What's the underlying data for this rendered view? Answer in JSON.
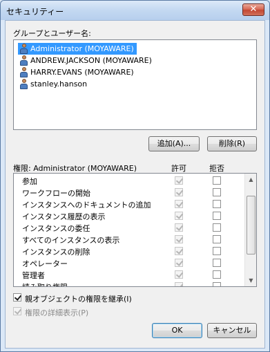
{
  "window": {
    "title": "セキュリティー",
    "close_symbol": "✕"
  },
  "users_label": "グループとユーザー名:",
  "users": [
    {
      "name": "Administrator (MOYAWARE)",
      "selected": true
    },
    {
      "name": "ANDREW.JACKSON (MOYAWARE)",
      "selected": false
    },
    {
      "name": "HARRY.EVANS (MOYAWARE)",
      "selected": false
    },
    {
      "name": "stanley.hanson",
      "selected": false
    }
  ],
  "buttons": {
    "add": "追加(A)...",
    "remove": "削除(R)",
    "ok": "OK",
    "cancel": "キャンセル"
  },
  "permissions_header": {
    "title": "権限: Administrator (MOYAWARE)",
    "allow": "許可",
    "deny": "拒否"
  },
  "permissions": [
    {
      "name": "参加",
      "allow": true,
      "deny": false
    },
    {
      "name": "ワークフローの開始",
      "allow": true,
      "deny": false
    },
    {
      "name": "インスタンスへのドキュメントの追加",
      "allow": true,
      "deny": false
    },
    {
      "name": "インスタンス履歴の表示",
      "allow": true,
      "deny": false
    },
    {
      "name": "インスタンスの委任",
      "allow": true,
      "deny": false
    },
    {
      "name": "すべてのインスタンスの表示",
      "allow": true,
      "deny": false
    },
    {
      "name": "インスタンスの削除",
      "allow": true,
      "deny": false
    },
    {
      "name": "オペレーター",
      "allow": true,
      "deny": false
    },
    {
      "name": "管理者",
      "allow": true,
      "deny": false
    },
    {
      "name": "読み取り権限",
      "allow": true,
      "deny": false
    }
  ],
  "inherit_label": "親オブジェクトの権限を継承(I)",
  "inherit_checked": true,
  "details_label": "権限の詳細表示(P)",
  "details_checked": true
}
